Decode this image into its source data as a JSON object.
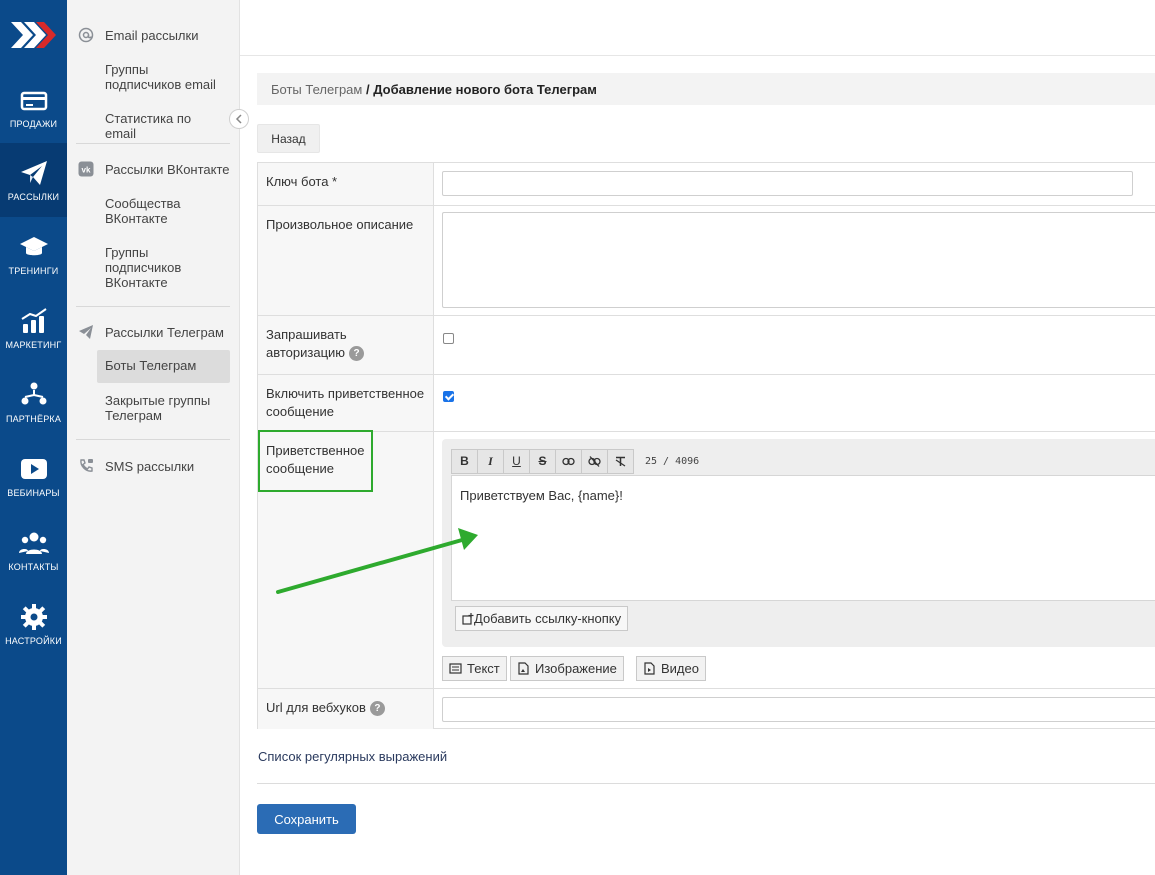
{
  "rail": {
    "items": [
      {
        "label": "ПРОДАЖИ",
        "icon": "credit-card-icon"
      },
      {
        "label": "РАССЫЛКИ",
        "icon": "paper-plane-icon"
      },
      {
        "label": "ТРЕНИНГИ",
        "icon": "graduation-cap-icon"
      },
      {
        "label": "МАРКЕТИНГ",
        "icon": "chart-growth-icon"
      },
      {
        "label": "ПАРТНЁРКА",
        "icon": "partners-icon"
      },
      {
        "label": "ВЕБИНАРЫ",
        "icon": "play-icon"
      },
      {
        "label": "КОНТАКТЫ",
        "icon": "people-icon"
      },
      {
        "label": "НАСТРОЙКИ",
        "icon": "gear-icon"
      }
    ]
  },
  "submenu": {
    "email_head": "Email рассылки",
    "email_groups": "Группы подписчиков email",
    "email_stats": "Статистика по email",
    "vk_head": "Рассылки ВКонтакте",
    "vk_communities": "Сообщества ВКонтакте",
    "vk_groups": "Группы подписчиков ВКонтакте",
    "tg_head": "Рассылки Телеграм",
    "tg_bots": "Боты Телеграм",
    "tg_groups": "Закрытые группы Телеграм",
    "sms_head": "SMS рассылки"
  },
  "breadcrumb": {
    "link": "Боты Телеграм",
    "separator": " / ",
    "current": "Добавление нового бота Телеграм"
  },
  "back_label": "Назад",
  "form": {
    "bot_key_label": "Ключ бота *",
    "bot_key_value": "",
    "description_label": "Произвольное описание",
    "ask_auth_label": "Запрашивать авторизацию",
    "ask_auth_checked": false,
    "welcome_enable_label": "Включить приветственное сообщение",
    "welcome_enable_checked": true,
    "welcome_label": "Приветственное сообщение",
    "toolbar": [
      "B",
      "I",
      "U",
      "S"
    ],
    "counter": "25 / 4096",
    "welcome_text": "Приветствуем Вас, {name}!",
    "add_link_button": "Добавить ссылку-кнопку",
    "media_buttons": [
      "Текст",
      "Изображение",
      "Видео"
    ],
    "webhook_label": "Url для вебхуков",
    "help_mark": "?"
  },
  "regex_link": "Список регулярных выражений",
  "save_label": "Сохранить",
  "colors": {
    "rail_bg": "#0b4a8a",
    "accent": "#2b6cb5",
    "highlight": "#2eaa2e"
  }
}
